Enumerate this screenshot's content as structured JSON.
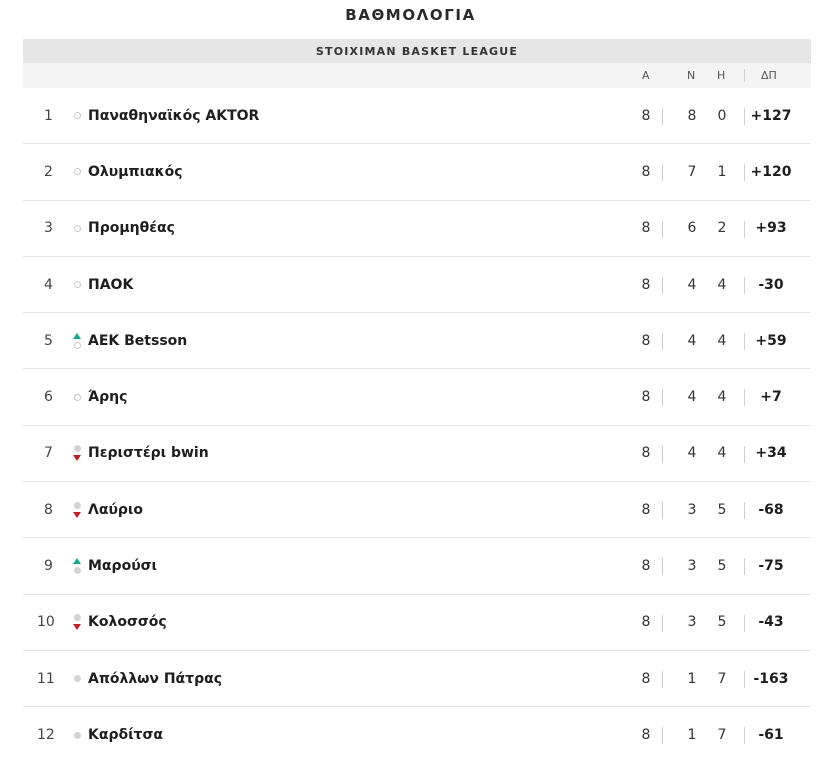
{
  "page": {
    "title": "ΒΑΘΜΟΛΟΓΙΑ"
  },
  "league": {
    "name": "STOIXIMAN BASKET LEAGUE"
  },
  "columns": {
    "played": "Α",
    "wins": "Ν",
    "losses": "Η",
    "diff": "ΔΠ"
  },
  "colors": {
    "up": "#1aa58d",
    "down": "#c0202a"
  },
  "rows": [
    {
      "rank": "1",
      "team": "Παναθηναϊκός AKTOR",
      "played": "8",
      "wins": "8",
      "losses": "0",
      "diff": "+127",
      "trend": "none",
      "marker": "hollow"
    },
    {
      "rank": "2",
      "team": "Ολυμπιακός",
      "played": "8",
      "wins": "7",
      "losses": "1",
      "diff": "+120",
      "trend": "none",
      "marker": "hollow"
    },
    {
      "rank": "3",
      "team": "Προμηθέας",
      "played": "8",
      "wins": "6",
      "losses": "2",
      "diff": "+93",
      "trend": "none",
      "marker": "hollow"
    },
    {
      "rank": "4",
      "team": "ΠΑΟΚ",
      "played": "8",
      "wins": "4",
      "losses": "4",
      "diff": "-30",
      "trend": "none",
      "marker": "hollow"
    },
    {
      "rank": "5",
      "team": "AEK Betsson",
      "played": "8",
      "wins": "4",
      "losses": "4",
      "diff": "+59",
      "trend": "up",
      "marker": "hollow"
    },
    {
      "rank": "6",
      "team": "Άρης",
      "played": "8",
      "wins": "4",
      "losses": "4",
      "diff": "+7",
      "trend": "none",
      "marker": "hollow"
    },
    {
      "rank": "7",
      "team": "Περιστέρι bwin",
      "played": "8",
      "wins": "4",
      "losses": "4",
      "diff": "+34",
      "trend": "down",
      "marker": "filled"
    },
    {
      "rank": "8",
      "team": "Λαύριο",
      "played": "8",
      "wins": "3",
      "losses": "5",
      "diff": "-68",
      "trend": "down",
      "marker": "filled"
    },
    {
      "rank": "9",
      "team": "Μαρούσι",
      "played": "8",
      "wins": "3",
      "losses": "5",
      "diff": "-75",
      "trend": "up",
      "marker": "filled"
    },
    {
      "rank": "10",
      "team": "Κολοσσός",
      "played": "8",
      "wins": "3",
      "losses": "5",
      "diff": "-43",
      "trend": "down",
      "marker": "filled"
    },
    {
      "rank": "11",
      "team": "Απόλλων Πάτρας",
      "played": "8",
      "wins": "1",
      "losses": "7",
      "diff": "-163",
      "trend": "none",
      "marker": "filled"
    },
    {
      "rank": "12",
      "team": "Καρδίτσα",
      "played": "8",
      "wins": "1",
      "losses": "7",
      "diff": "-61",
      "trend": "none",
      "marker": "filled"
    }
  ]
}
